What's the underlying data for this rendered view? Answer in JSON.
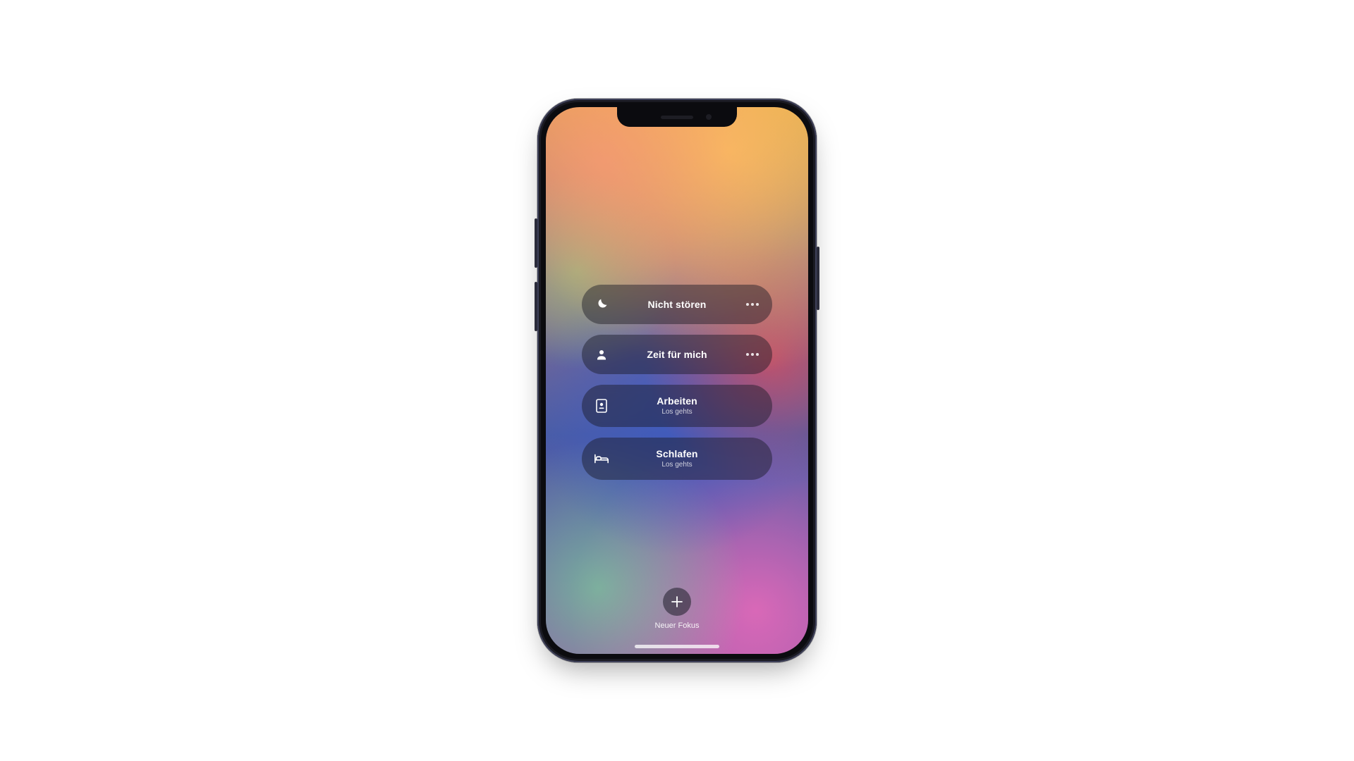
{
  "focus": {
    "items": [
      {
        "icon": "moon-icon",
        "label": "Nicht stören",
        "has_more": true
      },
      {
        "icon": "person-icon",
        "label": "Zeit für mich",
        "has_more": true
      },
      {
        "icon": "badge-icon",
        "label": "Arbeiten",
        "subtitle": "Los gehts"
      },
      {
        "icon": "bed-icon",
        "label": "Schlafen",
        "subtitle": "Los gehts"
      }
    ],
    "new_label": "Neuer Fokus"
  }
}
